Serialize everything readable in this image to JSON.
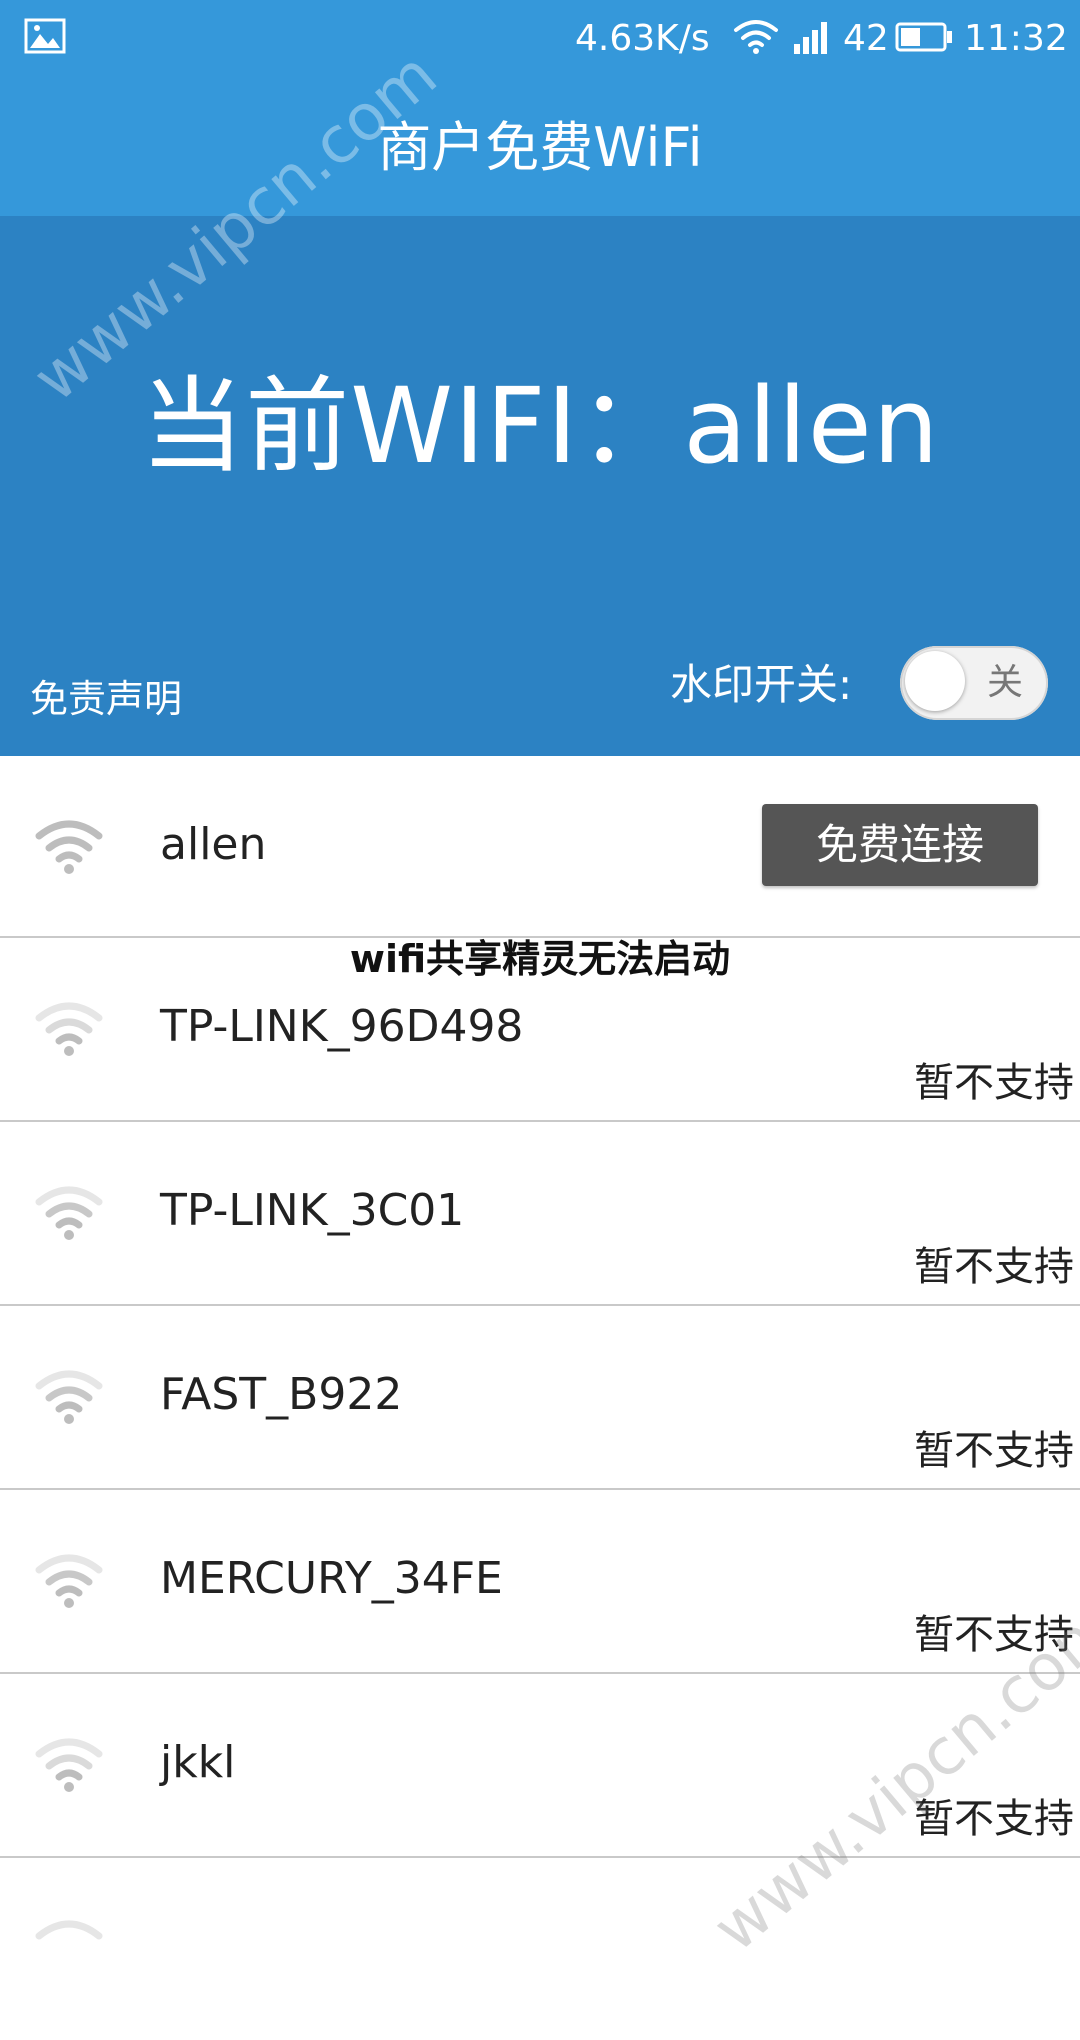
{
  "status_bar": {
    "speed": "4.63K/s",
    "battery": "42",
    "time": "11:32",
    "icons": [
      "gallery-icon",
      "wifi-icon",
      "signal-icon",
      "battery-icon"
    ]
  },
  "title_bar": {
    "title": "商户免费WiFi"
  },
  "hero": {
    "current_wifi": "当前WIFI：allen",
    "disclaimer": "免责声明",
    "watermark_label": "水印开关:",
    "watermark_toggle": {
      "state_label": "关",
      "on": false
    }
  },
  "networks": [
    {
      "ssid": "allen",
      "action": "免费连接"
    },
    {
      "ssid": "TP-LINK_96D498",
      "status": "暂不支持"
    },
    {
      "ssid": "TP-LINK_3C01",
      "status": "暂不支持"
    },
    {
      "ssid": "FAST_B922",
      "status": "暂不支持"
    },
    {
      "ssid": "MERCURY_34FE",
      "status": "暂不支持"
    },
    {
      "ssid": "jkkl",
      "status": "暂不支持"
    }
  ],
  "overlay_caption": "wifi共享精灵无法启动",
  "site_watermark": "www.vipcn.com",
  "colors": {
    "header": "#3598da",
    "hero": "#2c82c3",
    "button": "#555555"
  }
}
